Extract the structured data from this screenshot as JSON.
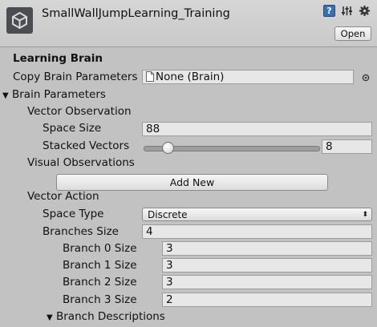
{
  "header": {
    "title": "SmallWallJumpLearning_Training",
    "help_glyph": "?",
    "open_label": "Open"
  },
  "section": {
    "title": "Learning Brain"
  },
  "copy_params": {
    "label": "Copy Brain Parameters",
    "value": "None (Brain)"
  },
  "brain_params": {
    "label": "Brain Parameters",
    "vector_observation": {
      "label": "Vector Observation",
      "space_size_label": "Space Size",
      "space_size_value": "88",
      "stacked_vectors_label": "Stacked Vectors",
      "stacked_vectors_value": "8",
      "stacked_vectors_slider_fraction": 0.14
    },
    "visual_observations": {
      "label": "Visual Observations",
      "add_new_label": "Add New"
    },
    "vector_action": {
      "label": "Vector Action",
      "space_type_label": "Space Type",
      "space_type_value": "Discrete",
      "branches_size_label": "Branches Size",
      "branches_size_value": "4",
      "branches": [
        {
          "label": "Branch 0 Size",
          "value": "3"
        },
        {
          "label": "Branch 1 Size",
          "value": "3"
        },
        {
          "label": "Branch 2 Size",
          "value": "3"
        },
        {
          "label": "Branch 3 Size",
          "value": "2"
        }
      ],
      "branch_descriptions_label": "Branch Descriptions"
    }
  },
  "colors": {
    "background": "#c2c2c2",
    "field": "#e7e7e7",
    "help_icon": "#3a6fb0"
  }
}
